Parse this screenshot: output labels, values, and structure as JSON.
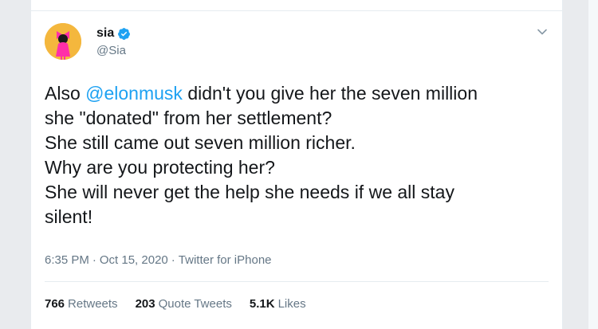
{
  "tweet": {
    "author": {
      "display_name": "sia",
      "handle": "@Sia",
      "verified": true
    },
    "text": {
      "l1_before": "Also ",
      "mention": "@elonmusk",
      "l1_after": " didn't you give her the seven million",
      "l2": "she \"donated\" from her settlement?",
      "l3": "She still came out seven million richer.",
      "l4": "Why are you protecting her?",
      "l5": "She will never get the help she needs if we all stay",
      "l6": "silent!"
    },
    "meta": {
      "time": "6:35 PM",
      "date": "Oct 15, 2020",
      "source": "Twitter for iPhone",
      "separator": "·"
    },
    "stats": {
      "retweets_count": "766",
      "retweets_label": "Retweets",
      "quotes_count": "203",
      "quotes_label": "Quote Tweets",
      "likes_count": "5.1K",
      "likes_label": "Likes"
    }
  },
  "icons": {
    "verified": "verified-badge-icon",
    "more": "chevron-down-icon"
  },
  "colors": {
    "link": "#1da1f2",
    "secondary_text": "#657786",
    "primary_text": "#14171a",
    "avatar_bg": "#f4b73d",
    "avatar_figure": "#ff2fa8"
  }
}
